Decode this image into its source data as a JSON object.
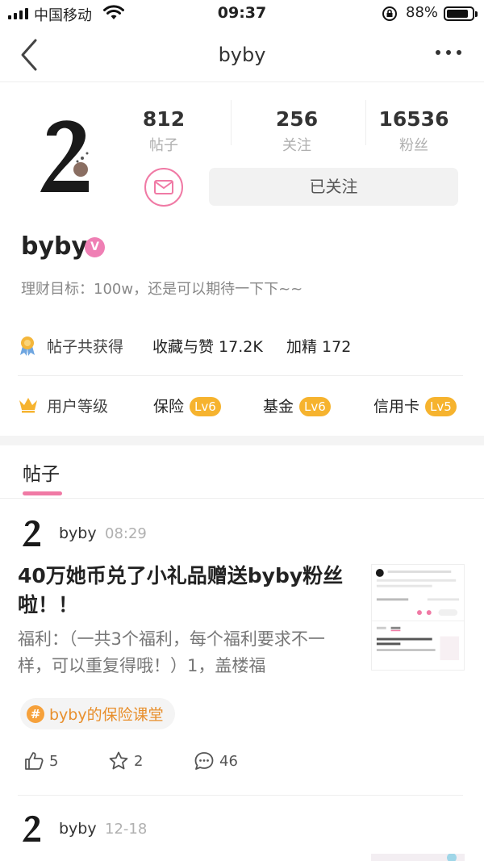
{
  "status_bar": {
    "carrier": "中国移动",
    "time": "09:37",
    "battery_percent": "88%",
    "battery_level": 0.88
  },
  "nav": {
    "title": "byby",
    "back_icon": "chevron-left-icon",
    "more_icon": "more-dots-icon"
  },
  "profile": {
    "stats": [
      {
        "value": "812",
        "label": "帖子"
      },
      {
        "value": "256",
        "label": "关注"
      },
      {
        "value": "16536",
        "label": "粉丝"
      }
    ],
    "follow_label": "已关注",
    "username": "byby",
    "verify_mark": "V",
    "bio": "理财目标：100w，还是可以期待一下下~~",
    "awards": {
      "label": "帖子共获得",
      "likes": "收藏与赞 17.2K",
      "featured": "加精 172"
    },
    "levels": {
      "label": "用户等级",
      "items": [
        {
          "name": "保险",
          "level": "Lv6"
        },
        {
          "name": "基金",
          "level": "Lv6"
        },
        {
          "name": "信用卡",
          "level": "Lv5"
        }
      ]
    }
  },
  "tabs": {
    "active": "帖子"
  },
  "posts": [
    {
      "author": "byby",
      "time": "08:29",
      "title": "40万她币兑了小礼品赠送byby粉丝啦！！",
      "body": "福利：（一共3个福利，每个福利要求不一样，可以重复得哦！）1，盖楼福",
      "topic": "byby的保险课堂",
      "topic_icon": "#",
      "likes": "5",
      "favorites": "2",
      "comments": "46"
    },
    {
      "author": "byby",
      "time": "12-18"
    }
  ],
  "colors": {
    "accent_pink": "#f07aa5",
    "level_badge": "#f6b32e",
    "topic_orange": "#e88f2c"
  }
}
